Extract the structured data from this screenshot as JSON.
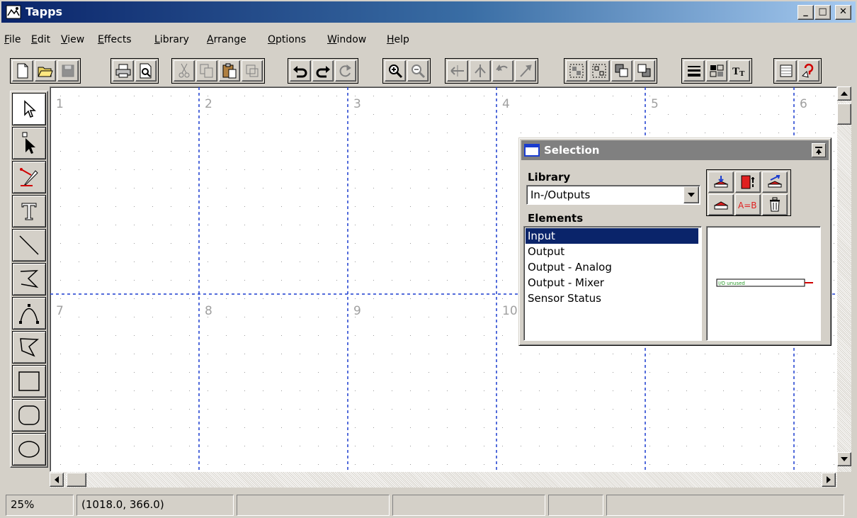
{
  "window": {
    "title": "Tapps",
    "minimize": "_",
    "maximize": "□",
    "close": "✕"
  },
  "menu": [
    {
      "u": "F",
      "rest": "ile"
    },
    {
      "u": "E",
      "rest": "dit"
    },
    {
      "u": "V",
      "rest": "iew"
    },
    {
      "u": "E",
      "rest": "ffects"
    },
    {
      "u": "L",
      "rest": "ibrary"
    },
    {
      "u": "A",
      "rest": "rrange"
    },
    {
      "u": "O",
      "rest": "ptions"
    },
    {
      "u": "W",
      "rest": "indow"
    },
    {
      "u": "H",
      "rest": "elp"
    }
  ],
  "canvas": {
    "page_numbers": [
      "1",
      "2",
      "3",
      "4",
      "5",
      "6",
      "7",
      "8",
      "9",
      "10"
    ]
  },
  "selection_panel": {
    "title": "Selection",
    "library_label": "Library",
    "library_value": "In-/Outputs",
    "elements_label": "Elements",
    "elements": [
      "Input",
      "Output",
      "Output - Analog",
      "Output - Mixer",
      "Sensor Status"
    ],
    "selected_index": 0,
    "ab_button_label": "A=B",
    "preview_label": "I/O  unused"
  },
  "status": {
    "zoom": "25%",
    "coords": "(1018.0, 366.0)"
  },
  "colors": {
    "title_start": "#0a246a",
    "title_end": "#a6caf0",
    "selection": "#0a246a",
    "page_grid": "#1a3ccf"
  }
}
